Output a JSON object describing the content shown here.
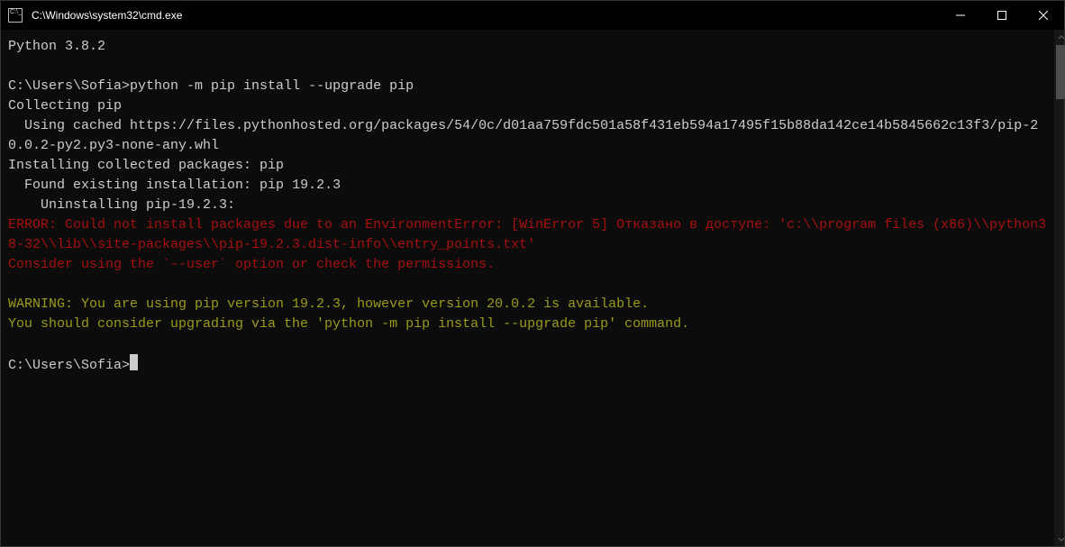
{
  "window": {
    "title": "C:\\Windows\\system32\\cmd.exe"
  },
  "terminal": {
    "line_python": "Python 3.8.2",
    "prompt1": "C:\\Users\\Sofia>",
    "cmd1": "python -m pip install --upgrade pip",
    "l_collecting": "Collecting pip",
    "l_cached": "  Using cached https://files.pythonhosted.org/packages/54/0c/d01aa759fdc501a58f431eb594a17495f15b88da142ce14b5845662c13f3/pip-20.0.2-py2.py3-none-any.whl",
    "l_installing": "Installing collected packages: pip",
    "l_found": "  Found existing installation: pip 19.2.3",
    "l_uninstall": "    Uninstalling pip-19.2.3:",
    "err1": "ERROR: Could not install packages due to an EnvironmentError: [WinError 5] Отказано в доступе: 'c:\\\\program files (x86)\\\\python38-32\\\\lib\\\\site-packages\\\\pip-19.2.3.dist-info\\\\entry_points.txt'",
    "err2": "Consider using the `--user` option or check the permissions.",
    "warn1": "WARNING: You are using pip version 19.2.3, however version 20.0.2 is available.",
    "warn2": "You should consider upgrading via the 'python -m pip install --upgrade pip' command.",
    "prompt2": "C:\\Users\\Sofia>"
  }
}
